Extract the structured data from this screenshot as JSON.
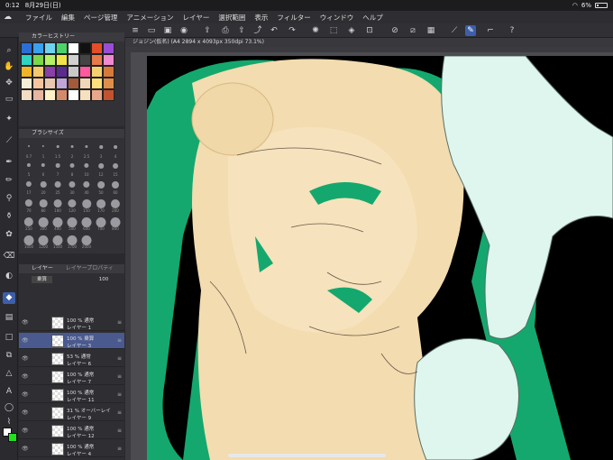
{
  "status": {
    "time": "0:12",
    "date": "8月29日(日)",
    "battery": "6%"
  },
  "menu": {
    "items": [
      "ファイル",
      "編集",
      "ページ管理",
      "アニメーション",
      "レイヤー",
      "選択範囲",
      "表示",
      "フィルター",
      "ウィンドウ",
      "ヘルプ"
    ]
  },
  "canvas": {
    "tab_title": "ジョジン(仮名) (A4 2894 x 4093px 350dpi 73.1%)"
  },
  "panels": {
    "color_history_title": "カラーヒストリー",
    "brush_size_title": "ブラシサイズ",
    "layer_tab": "レイヤー",
    "layer_property_tab": "レイヤープロパティ",
    "blend_mode": "乗算",
    "opacity": "100"
  },
  "swatches": [
    "#2b6fd6",
    "#3aa0f0",
    "#6fd3f0",
    "#4bd36a",
    "#ffffff",
    "#111111",
    "#e34d28",
    "#9b4dd6",
    "#2fd3c0",
    "#7ad84a",
    "#b6f069",
    "#f0e44a",
    "#d0d0d0",
    "#444444",
    "#e77a4b",
    "#f08ad0",
    "#f0b428",
    "#f5c86e",
    "#8b3fa8",
    "#5a2b8f",
    "#c8c8c8",
    "#ff5aa0",
    "#f4d16e",
    "#d67a3a",
    "#f7efd6",
    "#f6c59e",
    "#e8c9b0",
    "#bfa6d9",
    "#a25a3a",
    "#f0d7b8",
    "#ffe07a",
    "#e08f4a",
    "#f2dcc2",
    "#e7b6a0",
    "#fff2c8",
    "#d48a6a",
    "#ffffff",
    "#f6e0c0",
    "#e8a68a",
    "#c2532e"
  ],
  "brush_sizes": [
    "0.7",
    "1",
    "1.5",
    "2",
    "2.5",
    "3",
    "4",
    "5",
    "6",
    "7",
    "8",
    "10",
    "12",
    "15",
    "17",
    "20",
    "25",
    "30",
    "40",
    "50",
    "60",
    "70",
    "80",
    "100",
    "120",
    "150",
    "170",
    "200",
    "250",
    "300",
    "400",
    "500",
    "600",
    "700",
    "800",
    "1000",
    "1200",
    "1500",
    "1700",
    "2000"
  ],
  "layers": [
    {
      "opacity": "100 %",
      "mode": "通常",
      "name": "レイヤー 1"
    },
    {
      "opacity": "100 %",
      "mode": "乗算",
      "name": "レイヤー 3",
      "selected": true
    },
    {
      "opacity": "53 %",
      "mode": "通常",
      "name": "レイヤー 6"
    },
    {
      "opacity": "100 %",
      "mode": "通常",
      "name": "レイヤー 7"
    },
    {
      "opacity": "100 %",
      "mode": "通常",
      "name": "レイヤー 11"
    },
    {
      "opacity": "31 %",
      "mode": "オーバーレイ",
      "name": "レイヤー 9"
    },
    {
      "opacity": "100 %",
      "mode": "通常",
      "name": "レイヤー 12"
    },
    {
      "opacity": "100 %",
      "mode": "通常",
      "name": "レイヤー 4"
    }
  ],
  "colors": {
    "main": "#ffffff",
    "sub": "#20e020",
    "accent": "#3d5ea8",
    "artwork_green": "#14a86e",
    "artwork_skin": "#f2dcb0",
    "artwork_glove": "#dff6ee"
  }
}
